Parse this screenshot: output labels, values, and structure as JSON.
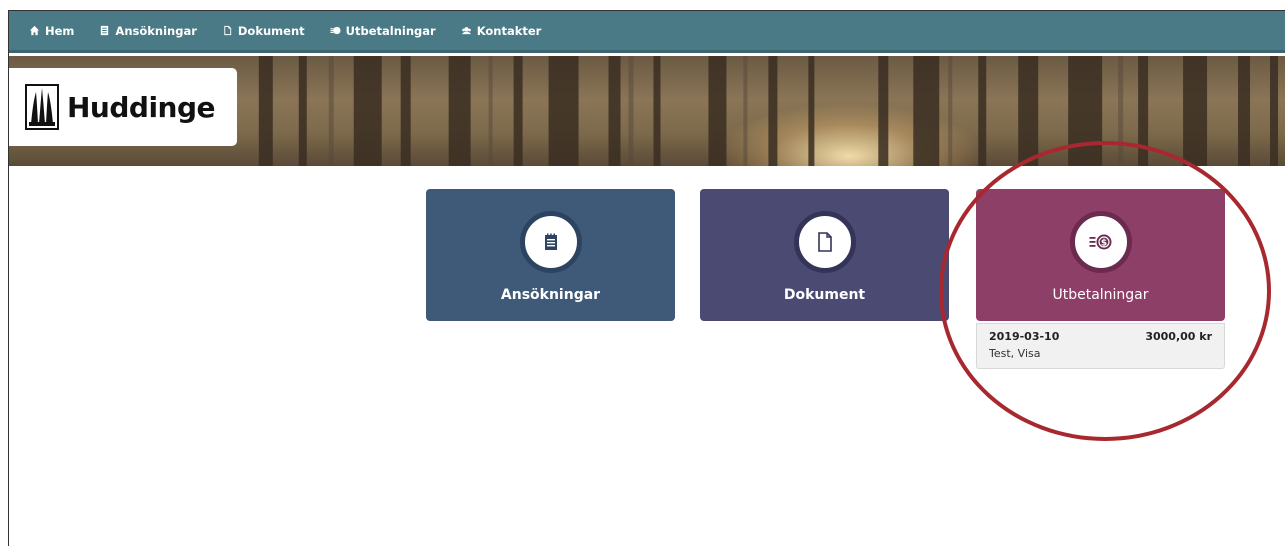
{
  "nav": {
    "items": [
      {
        "label": "Hem",
        "icon": "home-icon"
      },
      {
        "label": "Ansökningar",
        "icon": "application-icon"
      },
      {
        "label": "Dokument",
        "icon": "document-icon"
      },
      {
        "label": "Utbetalningar",
        "icon": "money-icon"
      },
      {
        "label": "Kontakter",
        "icon": "contacts-icon"
      }
    ]
  },
  "logo": {
    "text": "Huddinge",
    "icon": "huddinge-crest-icon"
  },
  "tiles": [
    {
      "label": "Ansökningar",
      "icon": "notepad-icon",
      "color": "#3f5a78"
    },
    {
      "label": "Dokument",
      "icon": "document-icon",
      "color": "#4a4a73"
    },
    {
      "label": "Utbetalningar",
      "icon": "money-icon",
      "color": "#8d3f68"
    }
  ],
  "payment": {
    "date": "2019-03-10",
    "amount": "3000,00 kr",
    "description": "Test, Visa"
  },
  "colors": {
    "nav": "#4a7a86",
    "highlight_circle": "#a8282f"
  }
}
